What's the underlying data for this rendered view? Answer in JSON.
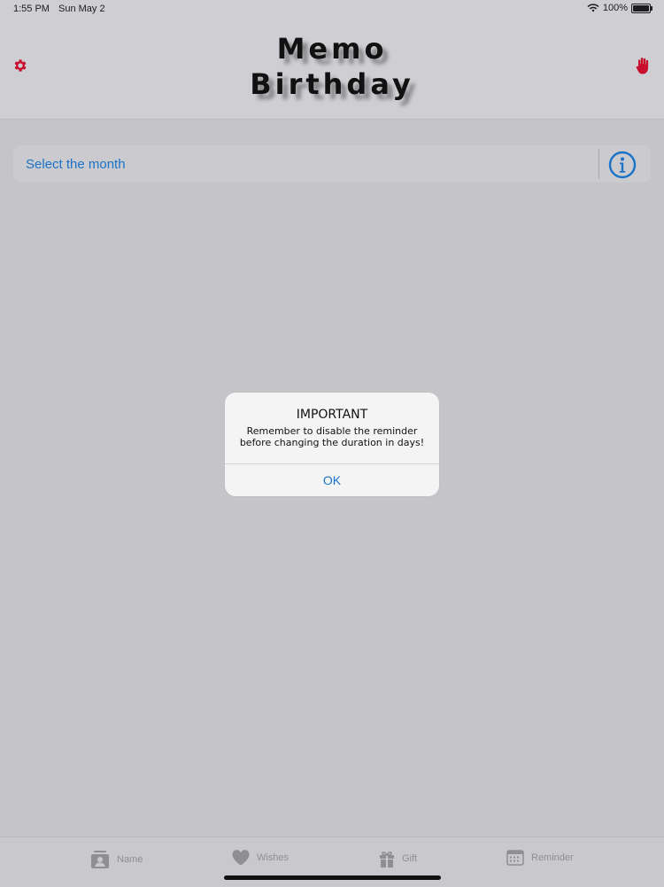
{
  "status": {
    "time": "1:55 PM",
    "date": "Sun May 2",
    "battery": "100%"
  },
  "header": {
    "title_line1": "Memo",
    "title_line2": "Birthday"
  },
  "month_selector": {
    "label": "Select the month"
  },
  "alert": {
    "title": "IMPORTANT",
    "message": "Remember to disable the reminder before changing the duration in days!",
    "ok_label": "OK"
  },
  "tabs": [
    {
      "label": "Name",
      "icon": "contact-card-icon"
    },
    {
      "label": "Wishes",
      "icon": "heart-icon"
    },
    {
      "label": "Gift",
      "icon": "gift-icon"
    },
    {
      "label": "Reminder",
      "icon": "calendar-icon"
    }
  ],
  "colors": {
    "accent": "#1a73c7",
    "danger": "#c8102e",
    "inactive": "#8e8e93"
  }
}
